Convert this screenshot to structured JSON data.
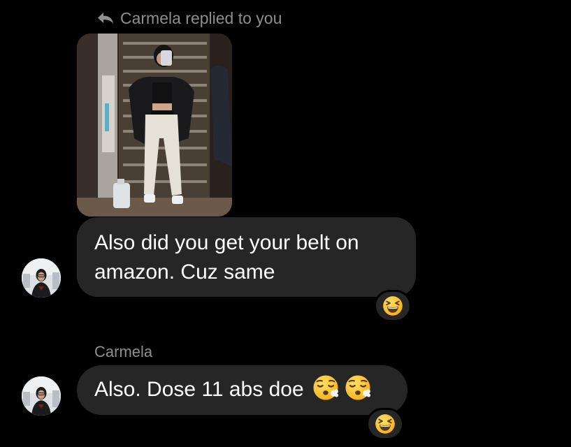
{
  "reply_context": {
    "text": "Carmela replied to you",
    "icon": "reply-arrow-icon"
  },
  "replied_photo": {
    "subject": "mirror-selfie-photo"
  },
  "messages": [
    {
      "text": "Also did you get your belt on amazon. Cuz same",
      "reaction": "laughing-squint-emoji"
    },
    {
      "sender": "Carmela",
      "text": "Also. Dose 11 abs doe",
      "emojis": [
        "tired-face-emoji",
        "tired-face-emoji"
      ],
      "reaction": "laughing-squint-emoji"
    }
  ],
  "colors": {
    "background": "#000000",
    "bubble": "#262626",
    "secondary_text": "#8e8e8e",
    "text": "#ffffff",
    "emoji": "#ffcc33"
  }
}
